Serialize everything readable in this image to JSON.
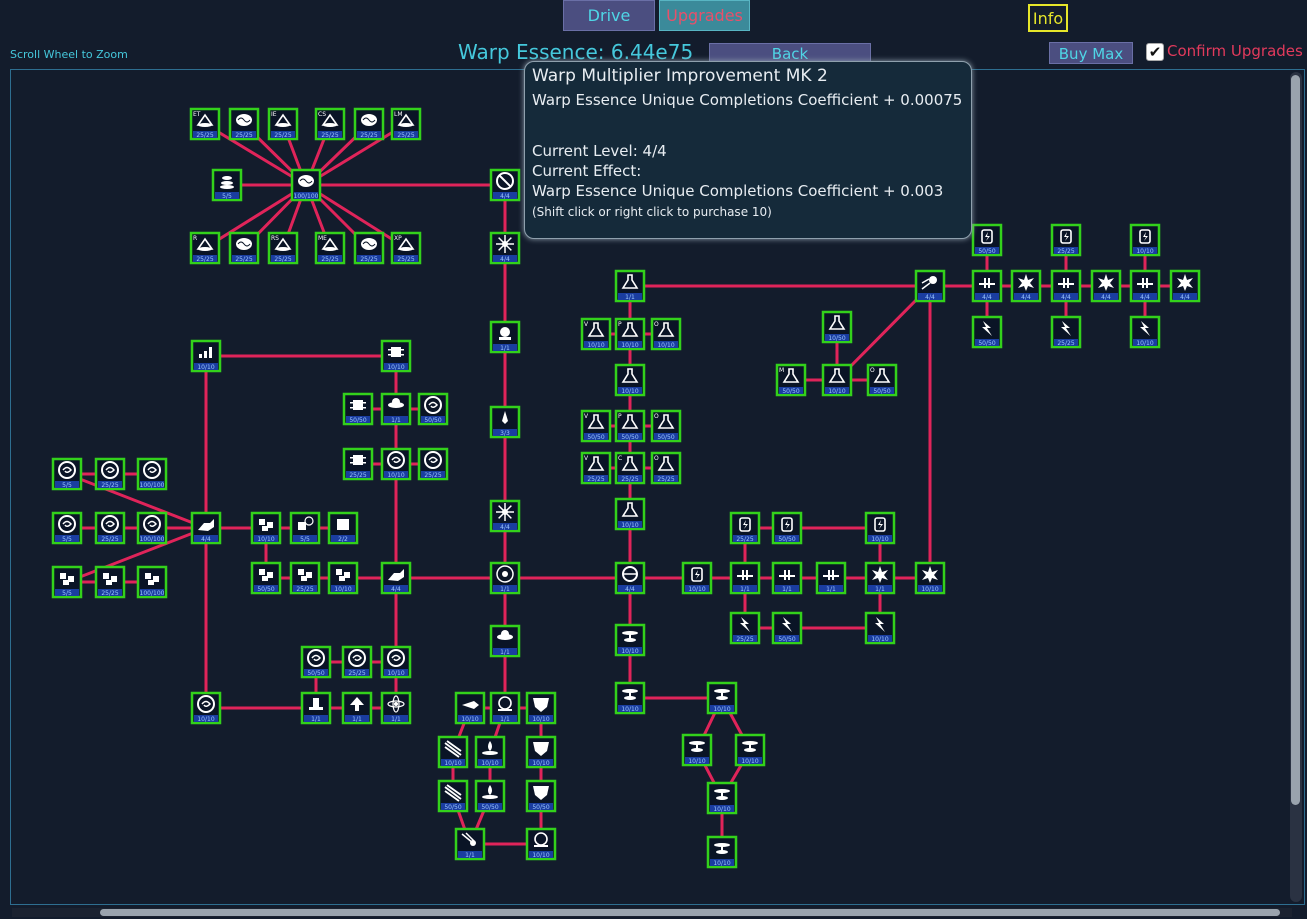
{
  "tabs": {
    "drive": "Drive",
    "upgrades": "Upgrades"
  },
  "info_label": "Info",
  "zoom_hint": "Scroll Wheel to Zoom",
  "essence_label": "Warp Essence: 6.44e75",
  "back_label": "Back",
  "buy_max_label": "Buy Max",
  "confirm_checked": true,
  "confirm_label": "Confirm Upgrades",
  "colors": {
    "node_border": "#33d11b",
    "edge": "#e0245a",
    "accent": "#45c8dc",
    "confirm": "#e23a5c"
  },
  "tooltip": {
    "title": "Warp Multiplier Improvement MK 2",
    "description": "Warp Essence Unique Completions Coefficient + 0.00075",
    "current_level": "Current Level: 4/4",
    "current_effect_label": "Current Effect:",
    "current_effect": "Warp Essence Unique Completions Coefficient + 0.003",
    "hint": "(Shift click or right click to purchase 10)"
  },
  "nodes": [
    {
      "id": "et",
      "icon": "cone-icon",
      "tag": "ET",
      "level": "25/25"
    },
    {
      "id": "b1",
      "icon": "brain-icon",
      "tag": "",
      "level": "25/25"
    },
    {
      "id": "ie",
      "icon": "cone-icon",
      "tag": "IE",
      "level": "25/25"
    },
    {
      "id": "cs",
      "icon": "cone-icon",
      "tag": "CS",
      "level": "25/25"
    },
    {
      "id": "b2",
      "icon": "brain-icon",
      "tag": "",
      "level": "25/25"
    },
    {
      "id": "lm",
      "icon": "cone-icon",
      "tag": "LM",
      "level": "25/25"
    },
    {
      "id": "s1",
      "icon": "stack-icon",
      "tag": "",
      "level": "5/5"
    },
    {
      "id": "bc",
      "icon": "brain-icon",
      "tag": "",
      "level": "100/100"
    },
    {
      "id": "r",
      "icon": "cone-icon",
      "tag": "R",
      "level": "25/25"
    },
    {
      "id": "b3",
      "icon": "brain-icon",
      "tag": "",
      "level": "25/25"
    },
    {
      "id": "rs",
      "icon": "cone-icon",
      "tag": "RS",
      "level": "25/25"
    },
    {
      "id": "me",
      "icon": "cone-icon",
      "tag": "ME",
      "level": "25/25"
    },
    {
      "id": "b4",
      "icon": "brain-icon",
      "tag": "",
      "level": "25/25"
    },
    {
      "id": "xp",
      "icon": "cone-icon",
      "tag": "XP",
      "level": "25/25"
    },
    {
      "id": "nx",
      "icon": "no-entry-icon",
      "tag": "",
      "level": "4/4"
    },
    {
      "id": "st1",
      "icon": "starburst-icon",
      "tag": "",
      "level": "4/4"
    },
    {
      "id": "gm",
      "icon": "gem-icon",
      "tag": "",
      "level": "1/1"
    },
    {
      "id": "rk",
      "icon": "rocket-icon",
      "tag": "",
      "level": "3/3"
    },
    {
      "id": "st2",
      "icon": "starburst-icon",
      "tag": "",
      "level": "4/4"
    },
    {
      "id": "core",
      "icon": "core-icon",
      "tag": "",
      "level": "1/1"
    },
    {
      "id": "orb",
      "icon": "orb-icon",
      "tag": "",
      "level": "1/1"
    },
    {
      "id": "gr",
      "icon": "growth-chart-icon",
      "tag": "",
      "level": "10/10"
    },
    {
      "id": "cp1",
      "icon": "circuit-icon",
      "tag": "",
      "level": "10/10"
    },
    {
      "id": "cp2",
      "icon": "circuit-icon",
      "tag": "",
      "level": "50/50"
    },
    {
      "id": "or2",
      "icon": "orb-icon",
      "tag": "",
      "level": "1/1"
    },
    {
      "id": "vx1",
      "icon": "vortex-icon",
      "tag": "",
      "level": "50/50"
    },
    {
      "id": "cp3",
      "icon": "circuit-icon",
      "tag": "",
      "level": "25/25"
    },
    {
      "id": "vx2",
      "icon": "vortex-icon",
      "tag": "",
      "level": "10/10"
    },
    {
      "id": "vx3",
      "icon": "vortex-icon",
      "tag": "",
      "level": "25/25"
    },
    {
      "id": "sw1",
      "icon": "swirl-icon",
      "tag": "",
      "level": "5/5"
    },
    {
      "id": "sw2",
      "icon": "swirl-icon",
      "tag": "",
      "level": "25/25"
    },
    {
      "id": "sw3",
      "icon": "swirl-icon",
      "tag": "",
      "level": "100/100"
    },
    {
      "id": "sw4",
      "icon": "swirl-icon",
      "tag": "",
      "level": "5/5"
    },
    {
      "id": "sw5",
      "icon": "swirl-icon",
      "tag": "",
      "level": "25/25"
    },
    {
      "id": "sw6",
      "icon": "swirl-icon",
      "tag": "",
      "level": "100/100"
    },
    {
      "id": "cb1",
      "icon": "cubes-icon",
      "tag": "",
      "level": "5/5"
    },
    {
      "id": "cb2",
      "icon": "cubes-icon",
      "tag": "",
      "level": "25/25"
    },
    {
      "id": "cb3",
      "icon": "cubes-icon",
      "tag": "",
      "level": "100/100"
    },
    {
      "id": "hd1",
      "icon": "hand-icon",
      "tag": "",
      "level": "4/4"
    },
    {
      "id": "cb4",
      "icon": "cubes-icon",
      "tag": "",
      "level": "10/10"
    },
    {
      "id": "ck1",
      "icon": "clock-cube-icon",
      "tag": "",
      "level": "5/5"
    },
    {
      "id": "cu1",
      "icon": "cube-icon",
      "tag": "",
      "level": "2/2"
    },
    {
      "id": "cb5",
      "icon": "cubes-icon",
      "tag": "",
      "level": "50/50"
    },
    {
      "id": "cb6",
      "icon": "cubes-icon",
      "tag": "",
      "level": "25/25"
    },
    {
      "id": "cb7",
      "icon": "cubes-icon",
      "tag": "",
      "level": "10/10"
    },
    {
      "id": "hd2",
      "icon": "hand-icon",
      "tag": "",
      "level": "4/4"
    },
    {
      "id": "sp1",
      "icon": "spiral-icon",
      "tag": "",
      "level": "10/10"
    },
    {
      "id": "vx4",
      "icon": "vortex-icon",
      "tag": "",
      "level": "50/50"
    },
    {
      "id": "vx5",
      "icon": "vortex-icon",
      "tag": "",
      "level": "25/25"
    },
    {
      "id": "vx6",
      "icon": "vortex-icon",
      "tag": "",
      "level": "10/10"
    },
    {
      "id": "pl",
      "icon": "pylon-icon",
      "tag": "",
      "level": "1/1"
    },
    {
      "id": "ar",
      "icon": "arrow-up-icon",
      "tag": "",
      "level": "1/1"
    },
    {
      "id": "at",
      "icon": "atom-icon",
      "tag": "",
      "level": "1/1"
    },
    {
      "id": "fl1",
      "icon": "flask-icon",
      "tag": "",
      "level": "1/1"
    },
    {
      "id": "flv",
      "icon": "flask-icon",
      "tag": "V",
      "level": "10/10"
    },
    {
      "id": "flp",
      "icon": "flask-icon",
      "tag": "P",
      "level": "10/10"
    },
    {
      "id": "flo",
      "icon": "flask-icon",
      "tag": "O",
      "level": "10/10"
    },
    {
      "id": "fl2",
      "icon": "flask-icon",
      "tag": "",
      "level": "10/10"
    },
    {
      "id": "flv2",
      "icon": "flask-icon",
      "tag": "V",
      "level": "50/50"
    },
    {
      "id": "flp2",
      "icon": "flask-icon",
      "tag": "P",
      "level": "50/50"
    },
    {
      "id": "flo2",
      "icon": "flask-icon",
      "tag": "O",
      "level": "50/50"
    },
    {
      "id": "flv3",
      "icon": "flask-icon",
      "tag": "V",
      "level": "25/25"
    },
    {
      "id": "flc3",
      "icon": "flask-icon",
      "tag": "C",
      "level": "25/25"
    },
    {
      "id": "flo3",
      "icon": "flask-icon",
      "tag": "O",
      "level": "25/25"
    },
    {
      "id": "fl3",
      "icon": "flask-icon",
      "tag": "",
      "level": "10/10"
    },
    {
      "id": "fa",
      "icon": "flask-icon",
      "tag": "",
      "level": "10/50"
    },
    {
      "id": "fm",
      "icon": "flask-icon",
      "tag": "M",
      "level": "50/50"
    },
    {
      "id": "fc",
      "icon": "flask-icon",
      "tag": "",
      "level": "10/10"
    },
    {
      "id": "fo",
      "icon": "flask-icon",
      "tag": "O",
      "level": "50/50"
    },
    {
      "id": "cm",
      "icon": "comet-icon",
      "tag": "",
      "level": "4/4"
    },
    {
      "id": "bt1",
      "icon": "battery-icon",
      "tag": "",
      "level": "50/50"
    },
    {
      "id": "bt2",
      "icon": "battery-icon",
      "tag": "",
      "level": "25/25"
    },
    {
      "id": "bt3",
      "icon": "battery-icon",
      "tag": "",
      "level": "10/10"
    },
    {
      "id": "pc1",
      "icon": "capacitor-icon",
      "tag": "",
      "level": "4/4"
    },
    {
      "id": "ex1",
      "icon": "explosion-icon",
      "tag": "",
      "level": "4/4"
    },
    {
      "id": "pc2",
      "icon": "capacitor-icon",
      "tag": "",
      "level": "4/4"
    },
    {
      "id": "ex2",
      "icon": "explosion-icon",
      "tag": "",
      "level": "4/4"
    },
    {
      "id": "pc3",
      "icon": "capacitor-icon",
      "tag": "",
      "level": "4/4"
    },
    {
      "id": "ex3",
      "icon": "explosion-icon",
      "tag": "",
      "level": "4/4"
    },
    {
      "id": "lt1",
      "icon": "lightning-icon",
      "tag": "",
      "level": "50/50"
    },
    {
      "id": "lt2",
      "icon": "lightning-icon",
      "tag": "",
      "level": "25/25"
    },
    {
      "id": "lt3",
      "icon": "lightning-icon",
      "tag": "",
      "level": "10/10"
    },
    {
      "id": "warp",
      "icon": "warp-drive-icon",
      "tag": "",
      "level": "4/4"
    },
    {
      "id": "bt4",
      "icon": "battery-icon",
      "tag": "",
      "level": "10/10"
    },
    {
      "id": "pc4",
      "icon": "capacitor-icon",
      "tag": "",
      "level": "1/1"
    },
    {
      "id": "pc5",
      "icon": "capacitor-icon",
      "tag": "",
      "level": "1/1"
    },
    {
      "id": "pc6",
      "icon": "capacitor-icon",
      "tag": "",
      "level": "1/1"
    },
    {
      "id": "ex4",
      "icon": "explosion-icon",
      "tag": "",
      "level": "1/1"
    },
    {
      "id": "ex5",
      "icon": "explosion-icon",
      "tag": "",
      "level": "10/10"
    },
    {
      "id": "bt5",
      "icon": "battery-icon",
      "tag": "",
      "level": "25/25"
    },
    {
      "id": "bt6",
      "icon": "battery-icon",
      "tag": "",
      "level": "50/50"
    },
    {
      "id": "bt7",
      "icon": "battery-icon",
      "tag": "",
      "level": "10/10"
    },
    {
      "id": "lt4",
      "icon": "lightning-icon",
      "tag": "",
      "level": "25/25"
    },
    {
      "id": "lt5",
      "icon": "lightning-icon",
      "tag": "",
      "level": "50/50"
    },
    {
      "id": "lt6",
      "icon": "lightning-icon",
      "tag": "",
      "level": "10/10"
    },
    {
      "id": "gy1",
      "icon": "gyro-icon",
      "tag": "",
      "level": "10/10"
    },
    {
      "id": "gy2",
      "icon": "gyro-icon",
      "tag": "",
      "level": "10/10"
    },
    {
      "id": "gy3",
      "icon": "gyro-icon",
      "tag": "",
      "level": "10/10"
    },
    {
      "id": "gy4",
      "icon": "gyro-icon",
      "tag": "",
      "level": "10/10"
    },
    {
      "id": "gy5",
      "icon": "gyro-icon",
      "tag": "",
      "level": "10/10"
    },
    {
      "id": "gy6",
      "icon": "gyro-icon",
      "tag": "",
      "level": "10/10"
    },
    {
      "id": "gy7",
      "icon": "gyro-icon",
      "tag": "",
      "level": "10/10"
    },
    {
      "id": "ms1",
      "icon": "missile-icon",
      "tag": "",
      "level": "10/10"
    },
    {
      "id": "rc1",
      "icon": "reactor-icon",
      "tag": "",
      "level": "1/1"
    },
    {
      "id": "hx1",
      "icon": "hex-shield-icon",
      "tag": "",
      "level": "10/10"
    },
    {
      "id": "bm1",
      "icon": "beam-icon",
      "tag": "",
      "level": "10/10"
    },
    {
      "id": "fn1",
      "icon": "fountain-icon",
      "tag": "",
      "level": "10/10"
    },
    {
      "id": "hx2",
      "icon": "hex-shield-icon",
      "tag": "",
      "level": "10/10"
    },
    {
      "id": "bm2",
      "icon": "beam-icon",
      "tag": "",
      "level": "50/50"
    },
    {
      "id": "fn2",
      "icon": "fountain-icon",
      "tag": "",
      "level": "50/50"
    },
    {
      "id": "hx3",
      "icon": "hex-shield-icon",
      "tag": "",
      "level": "50/50"
    },
    {
      "id": "mt",
      "icon": "meteor-icon",
      "tag": "",
      "level": "1/1"
    },
    {
      "id": "rc2",
      "icon": "reactor-icon",
      "tag": "",
      "level": "10/10"
    }
  ]
}
